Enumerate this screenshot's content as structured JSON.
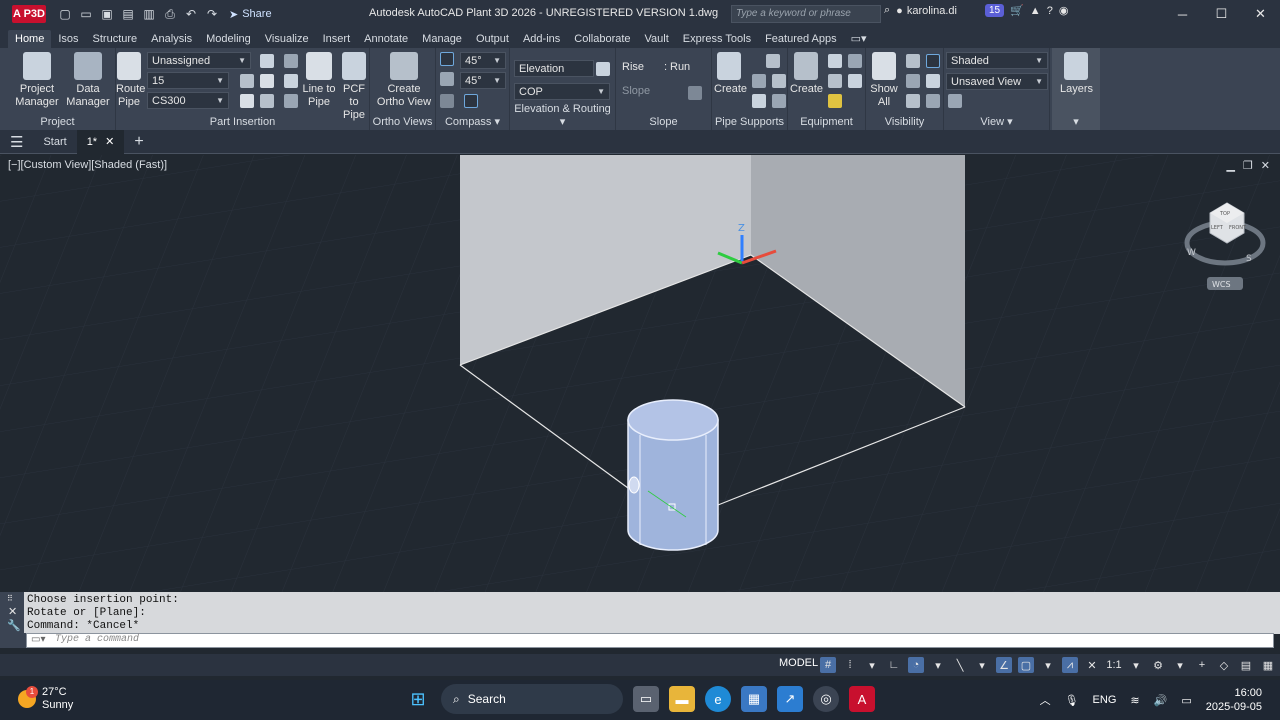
{
  "titlebar": {
    "app_badge": "A P3D",
    "share_label": "Share",
    "window_title": "Autodesk AutoCAD Plant 3D 2026 - UNREGISTERED VERSION    1.dwg",
    "search_placeholder": "Type a keyword or phrase",
    "user_name": "karolina.di",
    "notification_count": "15"
  },
  "ribbon_tabs": [
    "Home",
    "Isos",
    "Structure",
    "Analysis",
    "Modeling",
    "Visualize",
    "Insert",
    "Annotate",
    "Manage",
    "Output",
    "Add-ins",
    "Collaborate",
    "Vault",
    "Express Tools",
    "Featured Apps"
  ],
  "active_tab": "Home",
  "ribbon": {
    "project": {
      "title": "Project",
      "project_manager": "Project Manager",
      "data_manager": "Data Manager"
    },
    "part_insertion": {
      "title": "Part Insertion",
      "route_pipe": "Route Pipe",
      "line_to_pipe": "Line to Pipe",
      "pcf_to_pipe": "PCF to Pipe",
      "pcf_badge": "PCF",
      "service": "Unassigned",
      "size": "15",
      "spec": "CS300"
    },
    "ortho_views": {
      "title": "Ortho Views",
      "create_ortho": "Create Ortho View"
    },
    "compass": {
      "title": "Compass",
      "angle1": "45°",
      "angle2": "45°"
    },
    "elevation": {
      "title": "Elevation & Routing",
      "elevation_label": "Elevation",
      "cop_label": "COP"
    },
    "slope": {
      "title": "Slope",
      "rise": "Rise",
      "run": "Run",
      "slope_label": "Slope"
    },
    "pipe_supports": {
      "title": "Pipe Supports",
      "create": "Create"
    },
    "equipment": {
      "title": "Equipment",
      "create": "Create"
    },
    "visibility": {
      "title": "Visibility",
      "show_all": "Show All"
    },
    "view": {
      "title": "View",
      "visual_style": "Shaded",
      "named_view": "Unsaved View"
    },
    "layers": {
      "title": "Layers"
    }
  },
  "file_tabs": {
    "start": "Start",
    "drawing": "1*"
  },
  "viewport": {
    "label": "[−][Custom View][Shaded (Fast)]",
    "viewcube_top": "TOP",
    "viewcube_front": "FRONT",
    "viewcube_left": "LEFT",
    "compass_w": "W",
    "compass_s": "S",
    "wcs": "WCS",
    "ucs_z": "Z"
  },
  "command": {
    "history": [
      "Choose insertion point:",
      "Rotate or [Plane]:",
      "Command: *Cancel*"
    ],
    "placeholder": "Type a command"
  },
  "statusbar": {
    "model": "MODEL",
    "scale": "1:1"
  },
  "taskbar": {
    "temperature": "27°C",
    "weather": "Sunny",
    "weather_badge": "1",
    "search": "Search",
    "lang": "ENG",
    "time": "16:00",
    "date": "2025-09-05"
  },
  "colors": {
    "accent": "#4a6fa5",
    "brand": "#c8102e",
    "viewport_bg": "#212830",
    "ribbon_bg": "#3b4453"
  }
}
